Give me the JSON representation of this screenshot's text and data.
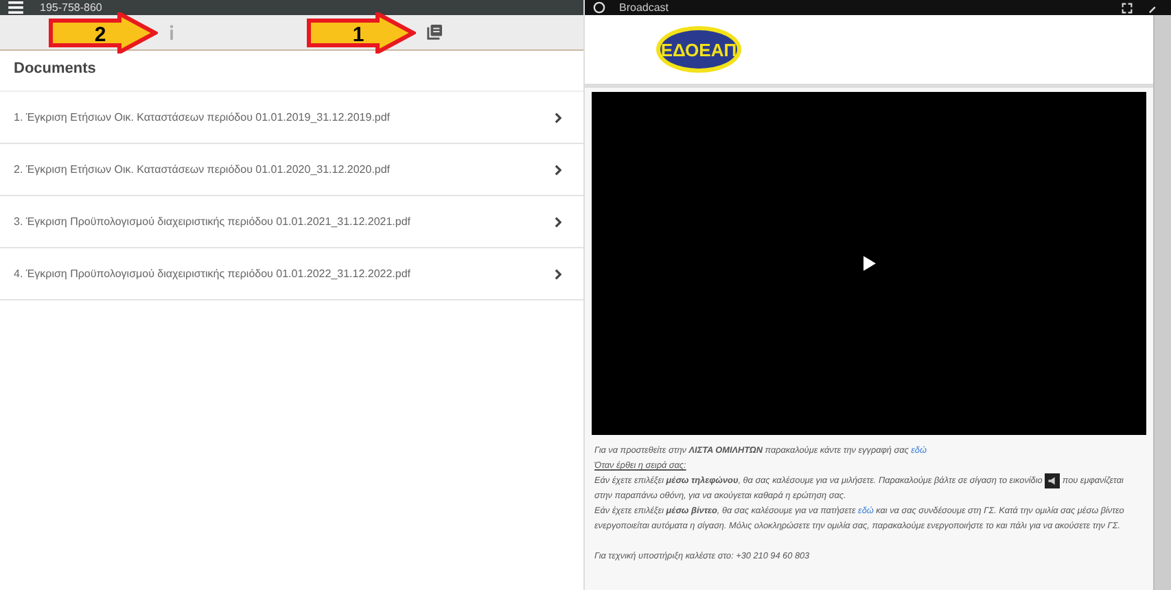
{
  "left_header": {
    "title": "195-758-860"
  },
  "toolbar": {
    "items": [
      {
        "kind": "info",
        "annotation": "2"
      },
      {
        "kind": "documents",
        "annotation": "1"
      }
    ]
  },
  "documents": {
    "title": "Documents",
    "items": [
      {
        "label": "1. Έγκριση Ετήσιων Οικ. Καταστάσεων περιόδου 01.01.2019_31.12.2019.pdf"
      },
      {
        "label": "2. Έγκριση Ετήσιων Οικ. Καταστάσεων περιόδου 01.01.2020_31.12.2020.pdf"
      },
      {
        "label": "3. Έγκριση Προϋπολογισμού διαχειριστικής περιόδου 01.01.2021_31.12.2021.pdf"
      },
      {
        "label": "4. Έγκριση Προϋπολογισμού διαχειριστικής περιόδου 01.01.2022_31.12.2022.pdf"
      }
    ]
  },
  "broadcast": {
    "title": "Broadcast",
    "logo": "ΕΔΟΕΑΠ",
    "paragraphs": [
      {
        "kind": "plain",
        "segments": [
          {
            "kind": "text",
            "text": "Για να προστεθείτε στην **ΛΙΣΤΑ ΟΜΙΛΗΤΩΝ** παρακαλούμε κάντε την εγγραφή σας "
          },
          {
            "kind": "link",
            "text": "εδώ"
          }
        ]
      },
      {
        "kind": "underlined",
        "segments": [
          {
            "kind": "text",
            "text": "Όταν έρθει η σειρά σας:"
          }
        ]
      },
      {
        "kind": "plain",
        "segments": [
          {
            "kind": "text",
            "text": "Εάν έχετε επιλέξει **μέσω τηλεφώνου**, θα σας καλέσουμε για να μιλήσετε. Παρακαλούμε βάλτε σε σίγαση το εικονίδιο "
          },
          {
            "kind": "icon"
          },
          {
            "kind": "text",
            "text": " που εμφανίζεται στην παραπάνω οθόνη, για να ακούγεται καθαρά η ερώτηση σας."
          }
        ]
      },
      {
        "kind": "plain",
        "segments": [
          {
            "kind": "text",
            "text": "Εάν έχετε επιλέξει **μέσω βίντεο**, θα σας καλέσουμε για να πατήσετε "
          },
          {
            "kind": "link",
            "text": "εδώ"
          },
          {
            "kind": "text",
            "text": " και να σας συνδέσουμε στη ΓΣ. Κατά την ομιλία σας μέσω βίντεο ενεργοποιείται αυτόματα η σίγαση. Μόλις ολοκληρώσετε την ομιλία σας, παρακαλούμε ενεργοποιήστε το και πάλι για να ακούσετε την ΓΣ."
          }
        ]
      },
      {
        "kind": "gap",
        "segments": [
          {
            "kind": "text",
            "text": "Για τεχνική υποστήριξη καλέστε στο: +30 210 94 60 803"
          }
        ]
      }
    ]
  }
}
